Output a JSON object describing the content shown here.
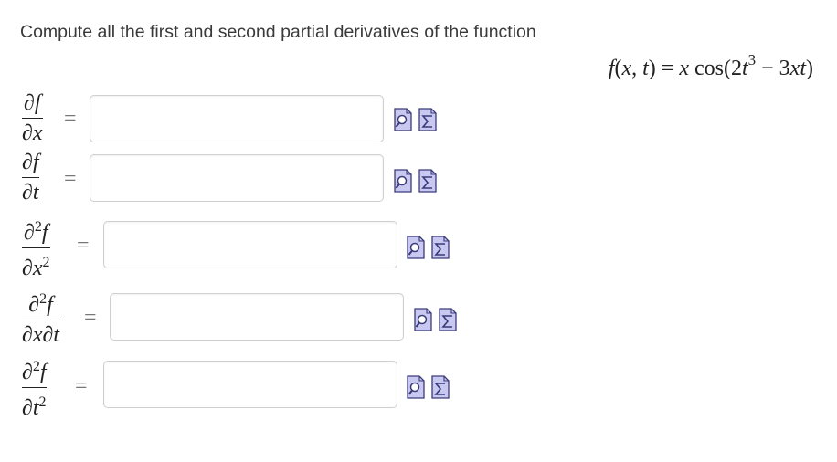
{
  "prompt": "Compute all the first and second partial derivatives of the function",
  "function_display": "f(x,t) = x cos(2t³ − 3xt)",
  "derivatives": [
    {
      "num": "∂f",
      "den": "∂x",
      "eq": "=",
      "value": ""
    },
    {
      "num": "∂f",
      "den": "∂t",
      "eq": "=",
      "value": ""
    },
    {
      "num": "∂²f",
      "den": "∂x²",
      "eq": "=",
      "value": ""
    },
    {
      "num": "∂²f",
      "den": "∂x∂t",
      "eq": "=",
      "value": ""
    },
    {
      "num": "∂²f",
      "den": "∂t²",
      "eq": "=",
      "value": ""
    }
  ],
  "icons": {
    "preview": "preview-magnifier-icon",
    "equation_editor": "sigma-editor-icon"
  },
  "colors": {
    "icon_fill": "#c8c8f0",
    "icon_stroke": "#3b3b7a",
    "input_border": "#cfcfcf",
    "text": "#3a3a3a"
  }
}
